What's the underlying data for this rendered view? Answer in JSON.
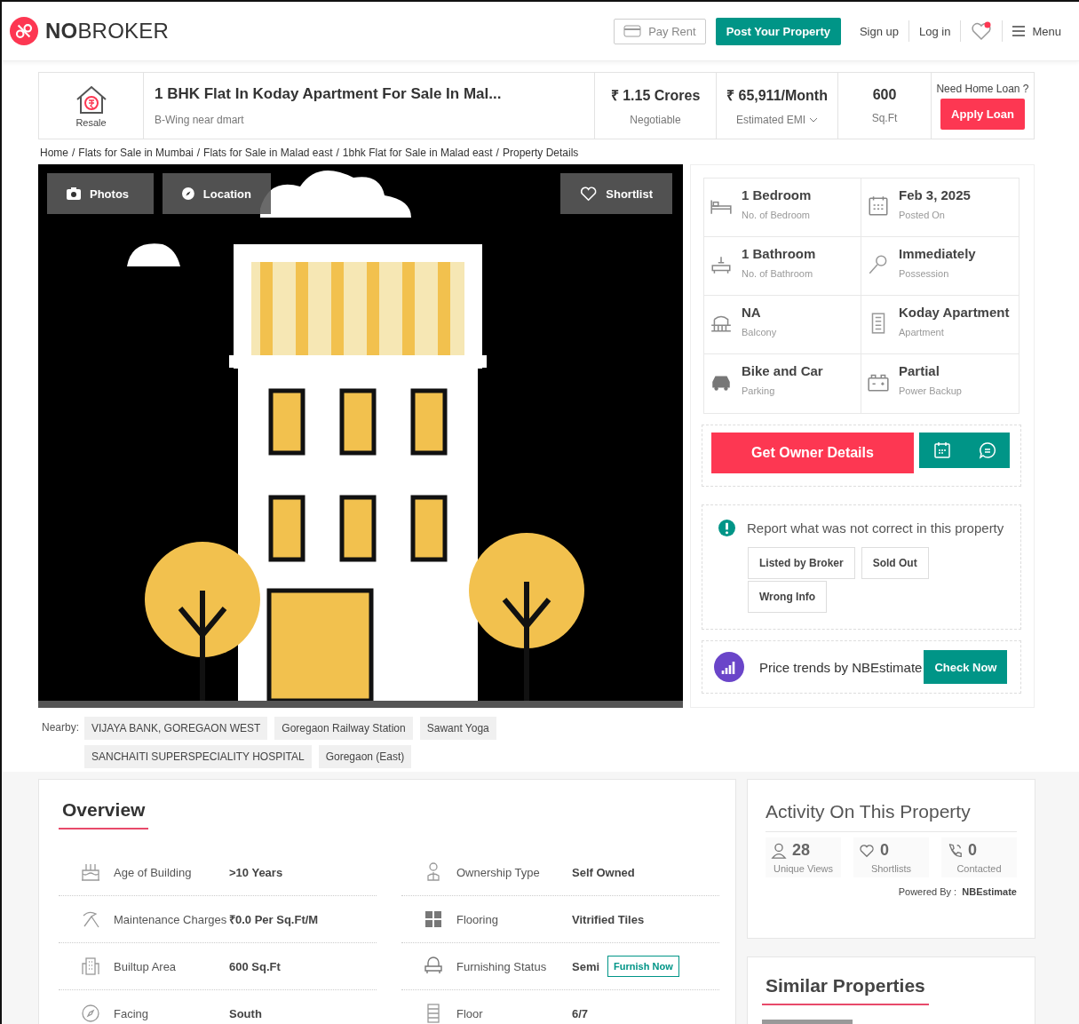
{
  "header": {
    "logo": "**NO**BROKER",
    "pay_rent": "Pay Rent",
    "post_property": "Post Your Property",
    "sign_up": "Sign up",
    "log_in": "Log in",
    "menu": "Menu"
  },
  "summary": {
    "badge": "Resale",
    "title": "1 BHK Flat In Koday Apartment For Sale In Mal...",
    "subtitle": "B-Wing near dmart",
    "price": "₹ 1.15 Crores",
    "price_note": "Negotiable",
    "emi": "₹ 65,911/Month",
    "emi_note": "Estimated EMI",
    "area": "600",
    "area_note": "Sq.Ft",
    "loan_question": "Need Home Loan ?",
    "loan_button": "Apply Loan"
  },
  "breadcrumb": {
    "separator": "/",
    "items": [
      "Home",
      "Flats for Sale in Mumbai",
      "Flats for Sale in Malad east",
      "1bhk Flat for Sale in Malad east",
      "Property Details"
    ]
  },
  "photo": {
    "photos_button": "Photos",
    "location_button": "Location",
    "shortlist_button": "Shortlist"
  },
  "facts": [
    {
      "kind": "bed",
      "value": "1 Bedroom",
      "label": "No. of Bedroom"
    },
    {
      "kind": "calendar",
      "value": "Feb 3, 2025",
      "label": "Posted On"
    },
    {
      "kind": "bath",
      "value": "1 Bathroom",
      "label": "No. of Bathroom"
    },
    {
      "kind": "key",
      "value": "Immediately",
      "label": "Possession"
    },
    {
      "kind": "balcony",
      "value": "NA",
      "label": "Balcony"
    },
    {
      "kind": "building",
      "value": "Koday Apartment",
      "label": "Apartment"
    },
    {
      "kind": "car",
      "value": "Bike and Car",
      "label": "Parking"
    },
    {
      "kind": "battery",
      "value": "Partial",
      "label": "Power Backup"
    }
  ],
  "owner_button": "Get Owner Details",
  "report": {
    "text": "Report what was not correct in this property",
    "options": [
      "Listed by Broker",
      "Sold Out",
      "Wrong Info"
    ]
  },
  "price_trends": {
    "text": "Price trends by NBEstimate",
    "button": "Check Now"
  },
  "nearby": {
    "label": "Nearby:",
    "places": [
      "VIJAYA BANK, GOREGAON WEST",
      "Goregaon Railway Station",
      "Sawant Yoga",
      "SANCHAITI SUPERSPECIALITY HOSPITAL",
      "Goregaon (East)"
    ]
  },
  "overview": {
    "title": "Overview",
    "rows": [
      {
        "kind": "cake",
        "label": "Age of Building",
        "value": ">10 Years"
      },
      {
        "kind": "person",
        "label": "Ownership Type",
        "value": "Self Owned"
      },
      {
        "kind": "tool",
        "label": "Maintenance Charges",
        "value": "₹0.0 Per Sq.Ft/M"
      },
      {
        "kind": "tiles",
        "label": "Flooring",
        "value": "Vitrified Tiles"
      },
      {
        "kind": "building",
        "label": "Builtup Area",
        "value": "600 Sq.Ft"
      },
      {
        "kind": "chair",
        "label": "Furnishing Status",
        "value": "Semi",
        "action": "Furnish Now"
      },
      {
        "kind": "compass",
        "label": "Facing",
        "value": "South"
      },
      {
        "kind": "floor",
        "label": "Floor",
        "value": "6/7"
      }
    ]
  },
  "activity": {
    "title": "Activity On This Property",
    "stats": [
      {
        "kind": "views",
        "value": "28",
        "label": "Unique Views"
      },
      {
        "kind": "heart",
        "value": "0",
        "label": "Shortlists"
      },
      {
        "kind": "phone",
        "value": "0",
        "label": "Contacted"
      }
    ],
    "powered_by": "Powered By :  **NBEstimate**"
  },
  "similar": {
    "title": "Similar Properties"
  }
}
